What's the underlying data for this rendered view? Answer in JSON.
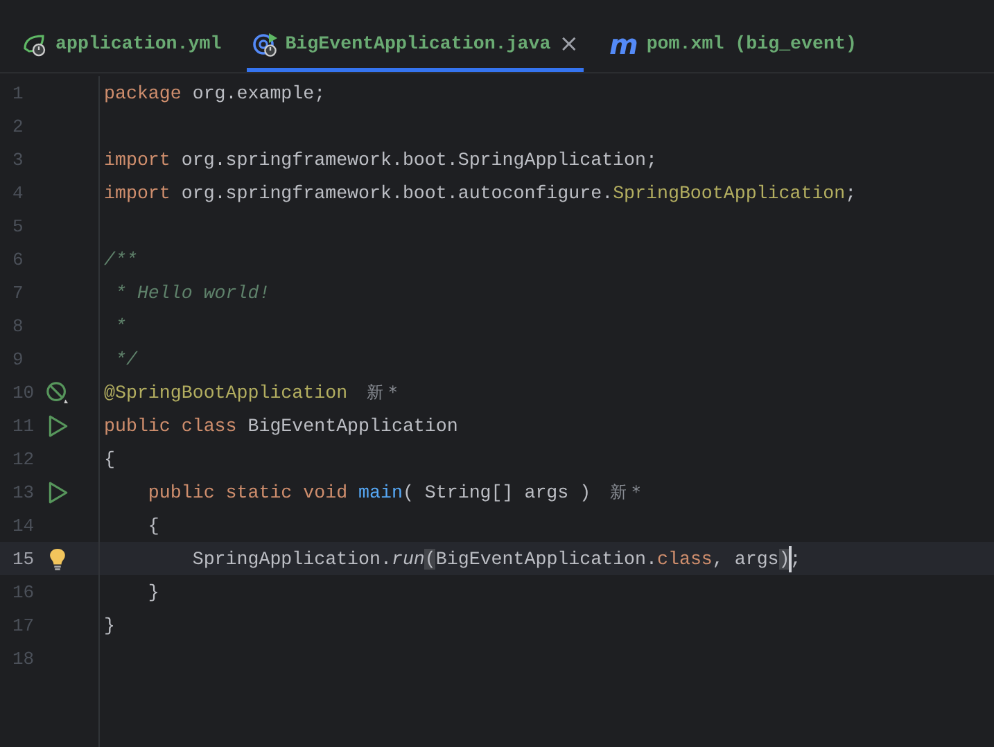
{
  "tabs": [
    {
      "label": "application.yml",
      "kind": "config",
      "selected": false
    },
    {
      "label": "BigEventApplication.java",
      "kind": "class",
      "selected": true,
      "close": "×"
    },
    {
      "label": "pom.xml (big_event)",
      "kind": "build",
      "logo": "m",
      "selected": false
    }
  ],
  "editor": {
    "lines": [
      {
        "number": "1",
        "tokens": [
          {
            "text": "package ",
            "kind": "keyword"
          },
          {
            "text": "org.example;",
            "kind": "plain"
          }
        ]
      },
      {
        "number": "2"
      },
      {
        "number": "3",
        "tokens": [
          {
            "text": "import ",
            "kind": "keyword"
          },
          {
            "text": "org.springframework.boot.SpringApplication;",
            "kind": "plain"
          }
        ]
      },
      {
        "number": "4",
        "tokens": [
          {
            "text": "import ",
            "kind": "keyword"
          },
          {
            "text": "org.springframework.boot.autoconfigure.",
            "kind": "plain"
          },
          {
            "text": "SpringBootApplication",
            "kind": "annotation"
          },
          {
            "text": ";",
            "kind": "plain"
          }
        ]
      },
      {
        "number": "5"
      },
      {
        "number": "6",
        "tokens": [
          {
            "text": "/**",
            "kind": "comment"
          }
        ]
      },
      {
        "number": "7",
        "tokens": [
          {
            "text": " * Hello world!",
            "kind": "comment"
          }
        ]
      },
      {
        "number": "8",
        "tokens": [
          {
            "text": " *",
            "kind": "comment"
          }
        ]
      },
      {
        "number": "9",
        "tokens": [
          {
            "text": " */",
            "kind": "comment"
          }
        ]
      },
      {
        "number": "10",
        "kind": "bean",
        "tokens": [
          {
            "text": "@SpringBootApplication",
            "kind": "annotation"
          }
        ],
        "hint": "新 *"
      },
      {
        "number": "11",
        "kind": "run",
        "tokens": [
          {
            "text": "public class ",
            "kind": "keyword"
          },
          {
            "text": "BigEventApplication",
            "kind": "plain"
          }
        ]
      },
      {
        "number": "12",
        "tokens": [
          {
            "text": "{",
            "kind": "plain"
          }
        ]
      },
      {
        "number": "13",
        "kind": "run",
        "tokens": [
          {
            "text": "    public static void ",
            "kind": "keyword"
          },
          {
            "text": "main",
            "kind": "method"
          },
          {
            "text": "( String[] args )",
            "kind": "plain"
          }
        ],
        "hint": "新 *"
      },
      {
        "number": "14",
        "tokens": [
          {
            "text": "    {",
            "kind": "plain"
          }
        ]
      },
      {
        "number": "15",
        "kind": "bulb",
        "current": true,
        "tokens": [
          {
            "text": "        SpringApplication.",
            "kind": "plain"
          },
          {
            "text": "run",
            "kind": "static-call"
          },
          {
            "text": "(",
            "kind": "bracket-match"
          },
          {
            "text": "BigEventApplication.",
            "kind": "plain"
          },
          {
            "text": "class",
            "kind": "keyword"
          },
          {
            "text": ", args",
            "kind": "plain"
          },
          {
            "text": ")",
            "kind": "bracket-match",
            "caret": true
          },
          {
            "text": ";",
            "kind": "plain"
          }
        ]
      },
      {
        "number": "16",
        "tokens": [
          {
            "text": "    }",
            "kind": "plain"
          }
        ]
      },
      {
        "number": "17",
        "tokens": [
          {
            "text": "}",
            "kind": "plain"
          }
        ]
      },
      {
        "number": "18"
      }
    ]
  }
}
